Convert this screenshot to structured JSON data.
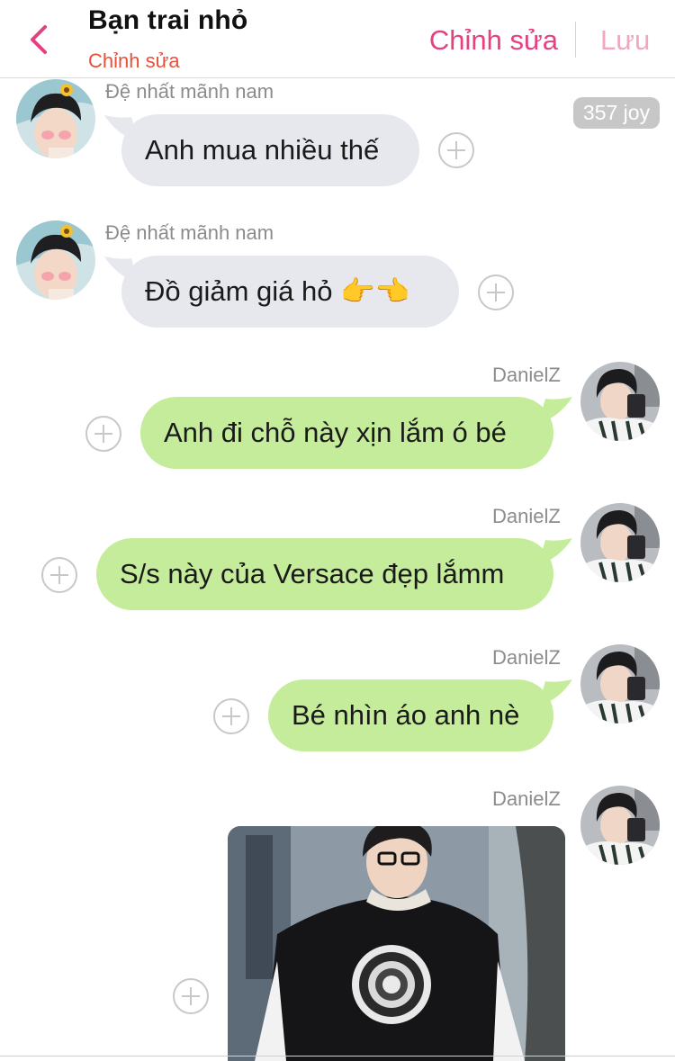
{
  "header": {
    "title": "Bạn trai nhỏ",
    "subtitle": "Chỉnh sửa",
    "edit_label": "Chỉnh sửa",
    "save_label": "Lưu",
    "accent": "#e5407f"
  },
  "joy_badge": "357 joy",
  "messages": [
    {
      "sender": "Đệ nhất mãnh nam",
      "text": "Anh mua nhiều thế",
      "side": "in"
    },
    {
      "sender": "Đệ nhất mãnh nam",
      "text": "Đồ giảm giá hỏ 👉👈",
      "side": "in"
    },
    {
      "sender": "DanielZ",
      "text": "Anh đi chỗ này xịn lắm ó bé",
      "side": "out"
    },
    {
      "sender": "DanielZ",
      "text": "S/s này của Versace đẹp lắmm",
      "side": "out"
    },
    {
      "sender": "DanielZ",
      "text": "Bé nhìn áo anh nè",
      "side": "out"
    },
    {
      "sender": "DanielZ",
      "type": "photo",
      "side": "out"
    }
  ],
  "colors": {
    "incoming_bubble": "#e6e8ed",
    "outgoing_bubble": "#c5ec9a",
    "subtitle": "#e8503a"
  }
}
